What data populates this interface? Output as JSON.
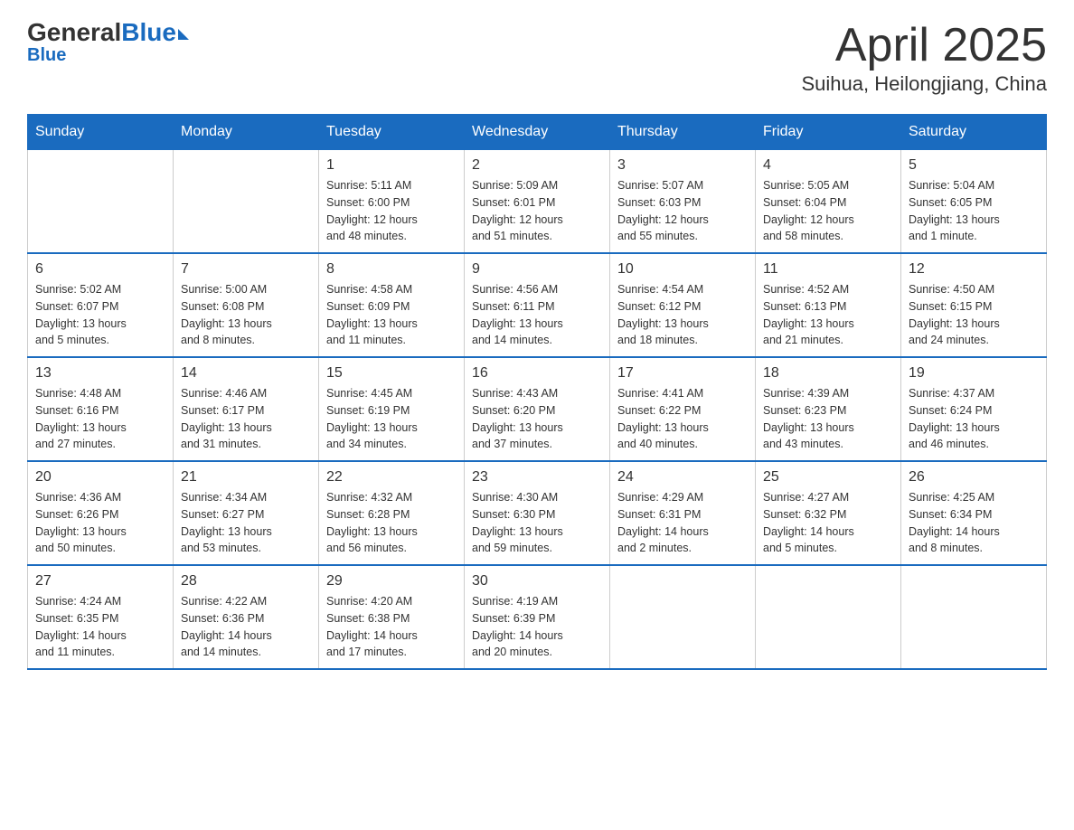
{
  "header": {
    "logo_general": "General",
    "logo_blue": "Blue",
    "month": "April 2025",
    "location": "Suihua, Heilongjiang, China"
  },
  "weekdays": [
    "Sunday",
    "Monday",
    "Tuesday",
    "Wednesday",
    "Thursday",
    "Friday",
    "Saturday"
  ],
  "weeks": [
    [
      {
        "day": "",
        "info": ""
      },
      {
        "day": "",
        "info": ""
      },
      {
        "day": "1",
        "info": "Sunrise: 5:11 AM\nSunset: 6:00 PM\nDaylight: 12 hours\nand 48 minutes."
      },
      {
        "day": "2",
        "info": "Sunrise: 5:09 AM\nSunset: 6:01 PM\nDaylight: 12 hours\nand 51 minutes."
      },
      {
        "day": "3",
        "info": "Sunrise: 5:07 AM\nSunset: 6:03 PM\nDaylight: 12 hours\nand 55 minutes."
      },
      {
        "day": "4",
        "info": "Sunrise: 5:05 AM\nSunset: 6:04 PM\nDaylight: 12 hours\nand 58 minutes."
      },
      {
        "day": "5",
        "info": "Sunrise: 5:04 AM\nSunset: 6:05 PM\nDaylight: 13 hours\nand 1 minute."
      }
    ],
    [
      {
        "day": "6",
        "info": "Sunrise: 5:02 AM\nSunset: 6:07 PM\nDaylight: 13 hours\nand 5 minutes."
      },
      {
        "day": "7",
        "info": "Sunrise: 5:00 AM\nSunset: 6:08 PM\nDaylight: 13 hours\nand 8 minutes."
      },
      {
        "day": "8",
        "info": "Sunrise: 4:58 AM\nSunset: 6:09 PM\nDaylight: 13 hours\nand 11 minutes."
      },
      {
        "day": "9",
        "info": "Sunrise: 4:56 AM\nSunset: 6:11 PM\nDaylight: 13 hours\nand 14 minutes."
      },
      {
        "day": "10",
        "info": "Sunrise: 4:54 AM\nSunset: 6:12 PM\nDaylight: 13 hours\nand 18 minutes."
      },
      {
        "day": "11",
        "info": "Sunrise: 4:52 AM\nSunset: 6:13 PM\nDaylight: 13 hours\nand 21 minutes."
      },
      {
        "day": "12",
        "info": "Sunrise: 4:50 AM\nSunset: 6:15 PM\nDaylight: 13 hours\nand 24 minutes."
      }
    ],
    [
      {
        "day": "13",
        "info": "Sunrise: 4:48 AM\nSunset: 6:16 PM\nDaylight: 13 hours\nand 27 minutes."
      },
      {
        "day": "14",
        "info": "Sunrise: 4:46 AM\nSunset: 6:17 PM\nDaylight: 13 hours\nand 31 minutes."
      },
      {
        "day": "15",
        "info": "Sunrise: 4:45 AM\nSunset: 6:19 PM\nDaylight: 13 hours\nand 34 minutes."
      },
      {
        "day": "16",
        "info": "Sunrise: 4:43 AM\nSunset: 6:20 PM\nDaylight: 13 hours\nand 37 minutes."
      },
      {
        "day": "17",
        "info": "Sunrise: 4:41 AM\nSunset: 6:22 PM\nDaylight: 13 hours\nand 40 minutes."
      },
      {
        "day": "18",
        "info": "Sunrise: 4:39 AM\nSunset: 6:23 PM\nDaylight: 13 hours\nand 43 minutes."
      },
      {
        "day": "19",
        "info": "Sunrise: 4:37 AM\nSunset: 6:24 PM\nDaylight: 13 hours\nand 46 minutes."
      }
    ],
    [
      {
        "day": "20",
        "info": "Sunrise: 4:36 AM\nSunset: 6:26 PM\nDaylight: 13 hours\nand 50 minutes."
      },
      {
        "day": "21",
        "info": "Sunrise: 4:34 AM\nSunset: 6:27 PM\nDaylight: 13 hours\nand 53 minutes."
      },
      {
        "day": "22",
        "info": "Sunrise: 4:32 AM\nSunset: 6:28 PM\nDaylight: 13 hours\nand 56 minutes."
      },
      {
        "day": "23",
        "info": "Sunrise: 4:30 AM\nSunset: 6:30 PM\nDaylight: 13 hours\nand 59 minutes."
      },
      {
        "day": "24",
        "info": "Sunrise: 4:29 AM\nSunset: 6:31 PM\nDaylight: 14 hours\nand 2 minutes."
      },
      {
        "day": "25",
        "info": "Sunrise: 4:27 AM\nSunset: 6:32 PM\nDaylight: 14 hours\nand 5 minutes."
      },
      {
        "day": "26",
        "info": "Sunrise: 4:25 AM\nSunset: 6:34 PM\nDaylight: 14 hours\nand 8 minutes."
      }
    ],
    [
      {
        "day": "27",
        "info": "Sunrise: 4:24 AM\nSunset: 6:35 PM\nDaylight: 14 hours\nand 11 minutes."
      },
      {
        "day": "28",
        "info": "Sunrise: 4:22 AM\nSunset: 6:36 PM\nDaylight: 14 hours\nand 14 minutes."
      },
      {
        "day": "29",
        "info": "Sunrise: 4:20 AM\nSunset: 6:38 PM\nDaylight: 14 hours\nand 17 minutes."
      },
      {
        "day": "30",
        "info": "Sunrise: 4:19 AM\nSunset: 6:39 PM\nDaylight: 14 hours\nand 20 minutes."
      },
      {
        "day": "",
        "info": ""
      },
      {
        "day": "",
        "info": ""
      },
      {
        "day": "",
        "info": ""
      }
    ]
  ]
}
